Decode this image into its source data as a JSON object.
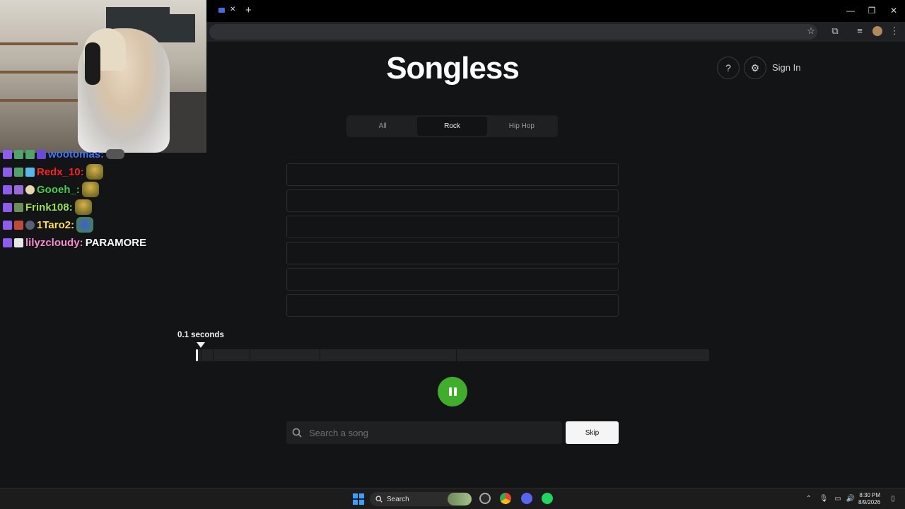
{
  "browser": {
    "tab_close": "✕",
    "new_tab": "+",
    "window_controls": {
      "minimize": "—",
      "restore": "❐",
      "close": "✕"
    }
  },
  "chat": {
    "lines": [
      {
        "user": "wootomas:",
        "color": "#3a7bff",
        "message": ""
      },
      {
        "user": "Redx_10:",
        "color": "#ff2222",
        "message": ""
      },
      {
        "user": "Gooeh_:",
        "color": "#3fd34a",
        "message": ""
      },
      {
        "user": "Frink108:",
        "color": "#9be44a",
        "message": ""
      },
      {
        "user": "1Taro2:",
        "color": "#ffe23a",
        "message": ""
      },
      {
        "user": "lilyzcloudy:",
        "color": "#ff8ad8",
        "message": "PARAMORE"
      }
    ]
  },
  "app": {
    "logo": "Songless",
    "help_label": "?",
    "sign_in": "Sign In",
    "genres": [
      {
        "label": "All",
        "active": false
      },
      {
        "label": "Rock",
        "active": true
      },
      {
        "label": "Hip Hop",
        "active": false
      }
    ],
    "seconds_label": "0.1 seconds",
    "progress_fraction": 0.004,
    "search_placeholder": "Search a song",
    "skip_label": "Skip"
  },
  "taskbar": {
    "search_label": "Search",
    "time": "8:30 PM",
    "date": "8/9/2026"
  },
  "colors": {
    "accent_green": "#3fae2a",
    "background": "#131415"
  }
}
